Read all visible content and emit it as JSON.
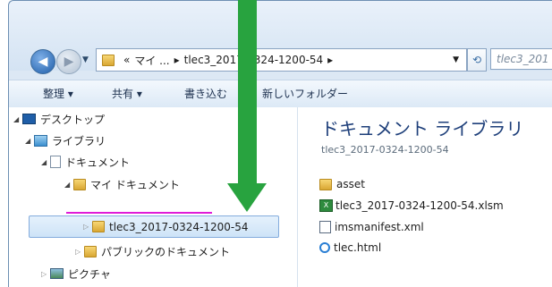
{
  "address": {
    "chevrons": "«",
    "path": [
      "マイ ...",
      "tlec3_2017-0324-1200-54"
    ],
    "sep": "▸",
    "search_placeholder": "tlec3_201"
  },
  "toolbar": {
    "organize": "整理 ▾",
    "share": "共有 ▾",
    "burn": "書き込む",
    "new_folder": "新しいフォルダー"
  },
  "tree": {
    "desktop": "デスクトップ",
    "libraries": "ライブラリ",
    "documents": "ドキュメント",
    "my_documents": "マイ ドキュメント",
    "selected_folder": "tlec3_2017-0324-1200-54",
    "public_documents": "パブリックのドキュメント",
    "pictures": "ピクチャ"
  },
  "content": {
    "title": "ドキュメント ライブラリ",
    "subtitle": "tlec3_2017-0324-1200-54",
    "files": [
      "asset",
      "tlec3_2017-0324-1200-54.xlsm",
      "imsmanifest.xml",
      "tlec.html"
    ]
  },
  "colors": {
    "annotation_arrow": "#28a33f",
    "annotation_underline": "#e01bd8"
  }
}
